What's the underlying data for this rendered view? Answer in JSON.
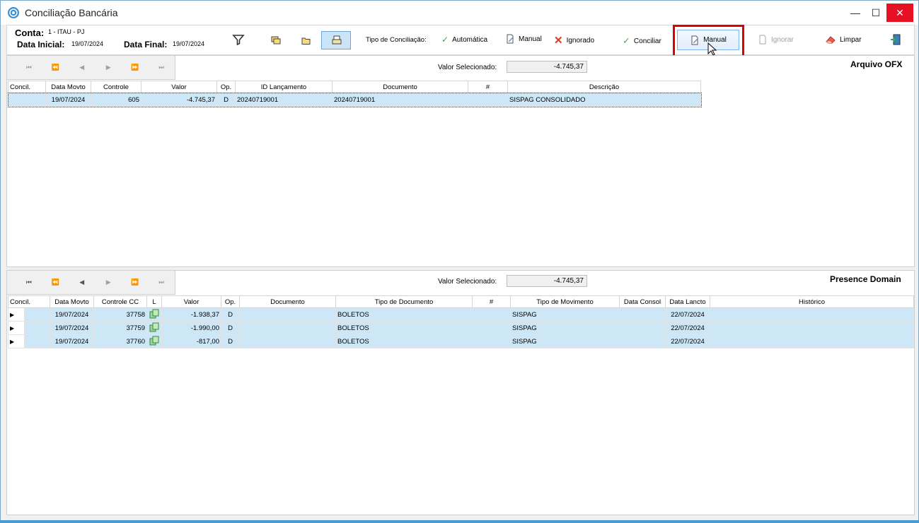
{
  "window": {
    "title": "Conciliação Bancária"
  },
  "filters": {
    "conta_label": "Conta:",
    "conta_value": "1 - ITAU - PJ",
    "data_inicial_label": "Data Inicial:",
    "data_inicial_value": "19/07/2024",
    "data_final_label": "Data Final:",
    "data_final_value": "19/07/2024"
  },
  "toolbar": {
    "tipo_label": "Tipo de Conciliação:",
    "automatica": "Automática",
    "manual_filter": "Manual",
    "ignorado": "Ignorado",
    "conciliar": "Conciliar",
    "manual_button": "Manual",
    "ignorar": "Ignorar",
    "limpar": "Limpar"
  },
  "ofx_panel": {
    "valor_label": "Valor Selecionado:",
    "valor_value": "-4.745,37",
    "title": "Arquivo OFX",
    "columns": [
      "Concil.",
      "Data Movto",
      "Controle",
      "Valor",
      "Op.",
      "ID Lançamento",
      "Documento",
      "#",
      "Descrição"
    ],
    "rows": [
      {
        "concil": "",
        "data": "19/07/2024",
        "controle": "605",
        "valor": "-4.745,37",
        "op": "D",
        "id": "20240719001",
        "documento": "20240719001",
        "hash": "",
        "descricao": "SISPAG CONSOLIDADO"
      }
    ]
  },
  "domain_panel": {
    "valor_label": "Valor Selecionado:",
    "valor_value": "-4.745,37",
    "title": "Presence Domain",
    "columns": [
      "Concil.",
      "Data Movto",
      "Controle CC",
      "L",
      "Valor",
      "Op.",
      "Documento",
      "Tipo de Documento",
      "#",
      "Tipo de Movimento",
      "Data Consol",
      "Data Lancto",
      "Histórico"
    ],
    "rows": [
      {
        "data": "19/07/2024",
        "controle": "37758",
        "valor": "-1.938,37",
        "op": "D",
        "documento": "",
        "tipo_doc": "BOLETOS",
        "hash": "",
        "tipo_mov": "SISPAG",
        "consol": "",
        "lancto": "22/07/2024",
        "historico": ""
      },
      {
        "data": "19/07/2024",
        "controle": "37759",
        "valor": "-1.990,00",
        "op": "D",
        "documento": "",
        "tipo_doc": "BOLETOS",
        "hash": "",
        "tipo_mov": "SISPAG",
        "consol": "",
        "lancto": "22/07/2024",
        "historico": ""
      },
      {
        "data": "19/07/2024",
        "controle": "37760",
        "valor": "-817,00",
        "op": "D",
        "documento": "",
        "tipo_doc": "BOLETOS",
        "hash": "",
        "tipo_mov": "SISPAG",
        "consol": "",
        "lancto": "22/07/2024",
        "historico": ""
      }
    ]
  }
}
